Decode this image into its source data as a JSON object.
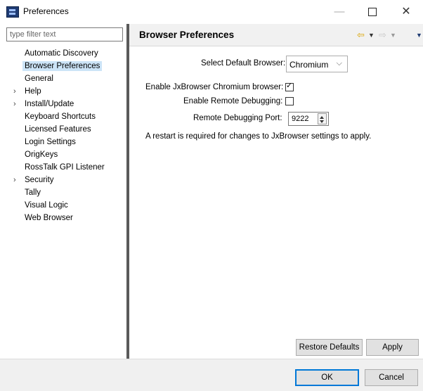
{
  "window": {
    "title": "Preferences",
    "minimize_glyph": "—",
    "close_glyph": "✕"
  },
  "filter": {
    "placeholder": "type filter text"
  },
  "tree": {
    "items": [
      {
        "label": "Automatic Discovery",
        "expandable": false,
        "selected": false
      },
      {
        "label": "Browser Preferences",
        "expandable": false,
        "selected": true
      },
      {
        "label": "General",
        "expandable": false,
        "selected": false
      },
      {
        "label": "Help",
        "expandable": true,
        "selected": false
      },
      {
        "label": "Install/Update",
        "expandable": true,
        "selected": false
      },
      {
        "label": "Keyboard Shortcuts",
        "expandable": false,
        "selected": false
      },
      {
        "label": "Licensed Features",
        "expandable": false,
        "selected": false
      },
      {
        "label": "Login Settings",
        "expandable": false,
        "selected": false
      },
      {
        "label": "OrigKeys",
        "expandable": false,
        "selected": false
      },
      {
        "label": "RossTalk GPI Listener",
        "expandable": false,
        "selected": false
      },
      {
        "label": "Security",
        "expandable": true,
        "selected": false
      },
      {
        "label": "Tally",
        "expandable": false,
        "selected": false
      },
      {
        "label": "Visual Logic",
        "expandable": false,
        "selected": false
      },
      {
        "label": "Web Browser",
        "expandable": false,
        "selected": false
      }
    ],
    "expand_glyph": "›"
  },
  "page": {
    "title": "Browser Preferences",
    "nav": {
      "back_icon": "back-arrow-icon",
      "forward_icon": "forward-arrow-icon",
      "back_glyph": "⇦",
      "forward_glyph": "⇨",
      "dropdown_glyph": "▼"
    },
    "default_browser": {
      "label": "Select Default Browser:",
      "value": "Chromium",
      "arrow_glyph": "⌵"
    },
    "enable_jx": {
      "label": "Enable JxBrowser Chromium browser:",
      "checked": true,
      "check_glyph": "✓"
    },
    "enable_remote": {
      "label": "Enable Remote Debugging:",
      "checked": false
    },
    "remote_port": {
      "label": "Remote Debugging Port:",
      "value": "9222"
    },
    "note": "A restart is required for changes to JxBrowser settings to apply.",
    "restore_defaults": "Restore Defaults",
    "apply": "Apply"
  },
  "dialog": {
    "ok": "OK",
    "cancel": "Cancel"
  },
  "colors": {
    "selection": "#cce4f7",
    "accent": "#0078d7",
    "nav_back": "#d9a300"
  }
}
